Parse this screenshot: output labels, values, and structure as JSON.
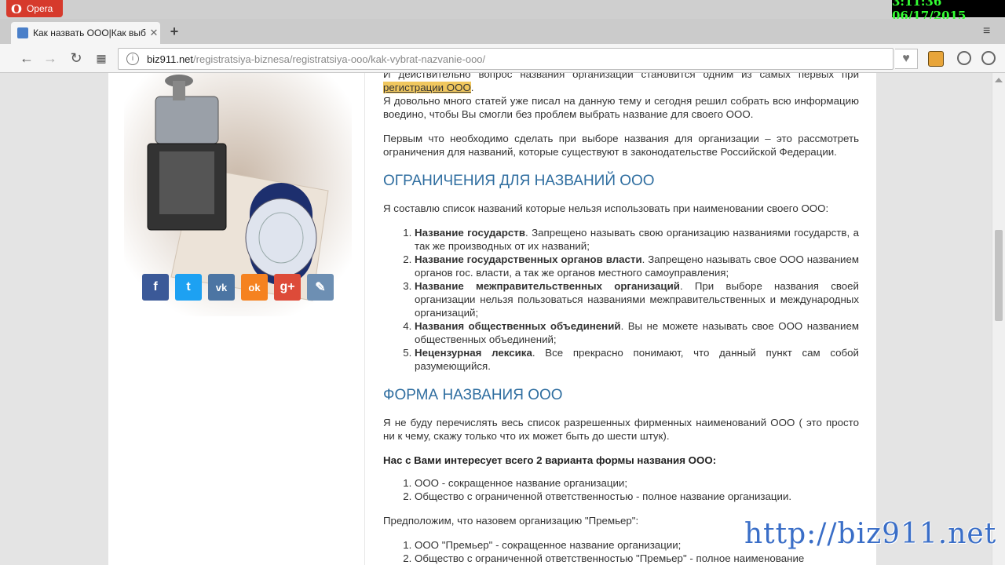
{
  "window": {
    "app_name": "Opera",
    "clock": "3:11:36  06/17/2015"
  },
  "tab": {
    "title": "Как назвать ООО|Как выб"
  },
  "address_bar": {
    "host": "biz911.net",
    "path": "/registratsiya-biznesa/registratsiya-ooo/kak-vybrat-nazvanie-ooo/"
  },
  "social": [
    {
      "name": "facebook",
      "label": "f",
      "color": "#3b5998"
    },
    {
      "name": "twitter",
      "label": "t",
      "color": "#1da1f2"
    },
    {
      "name": "vk",
      "label": "vk",
      "color": "#4c75a3"
    },
    {
      "name": "odnoklassniki",
      "label": "ok",
      "color": "#f58220"
    },
    {
      "name": "google-plus",
      "label": "g+",
      "color": "#dd4b39"
    },
    {
      "name": "edit",
      "label": "✎",
      "color": "#6d8fb3"
    }
  ],
  "article": {
    "intro_1a": "И действительно вопрос названия организации становится одним из самых первых при ",
    "intro_1_link": "регистрации ООО",
    "intro_1b": ".",
    "intro_2": "Я довольно много статей уже писал на данную тему и сегодня решил собрать всю информацию воедино, чтобы Вы смогли без проблем выбрать название для своего ООО.",
    "intro_3": "Первым что необходимо сделать при выборе названия для организации – это рассмотреть ограничения для названий, которые существуют в законодательстве Российской Федерации.",
    "h_restrictions": "ОГРАНИЧЕНИЯ ДЛЯ НАЗВАНИЙ ООО",
    "restrictions_lead": "Я составлю список названий которые нельзя использовать при наименовании своего ООО:",
    "restrictions": [
      {
        "bold": "Название государств",
        "text": ". Запрещено называть свою организацию названиями государств, а так же производных от их названий;"
      },
      {
        "bold": "Название государственных органов власти",
        "text": ". Запрещено называть свое ООО названием органов гос. власти, а так же органов местного самоуправления;"
      },
      {
        "bold": "Название межправительственных организаций",
        "text": ". При выборе названия своей организации нельзя пользоваться названиями межправительственных и международных организаций;"
      },
      {
        "bold": "Названия общественных объединений",
        "text": ". Вы не можете называть свое ООО названием общественных объединений;"
      },
      {
        "bold": "Нецензурная лексика",
        "text": ". Все прекрасно понимают, что данный пункт сам собой разумеющийся."
      }
    ],
    "h_form": "ФОРМА НАЗВАНИЯ ООО",
    "form_lead": "Я не буду перечислять весь список разрешенных фирменных наименований ООО ( это просто ни к чему, скажу только что их может быть до шести штук).",
    "form_bold": "Нас с Вами интересует всего 2 варианта формы названия ООО:",
    "form_items": [
      "ООО - сокращенное название организации;",
      "Общество с ограниченной ответственностью - полное название организации."
    ],
    "example_lead": "Предположим, что назовем организацию \"Премьер\":",
    "example_items": [
      "ООО \"Премьер\" - сокращенное название организации;",
      "Общество с ограниченной ответственностью \"Премьер\" - полное наименование"
    ]
  },
  "watermark": "http://biz911.net"
}
